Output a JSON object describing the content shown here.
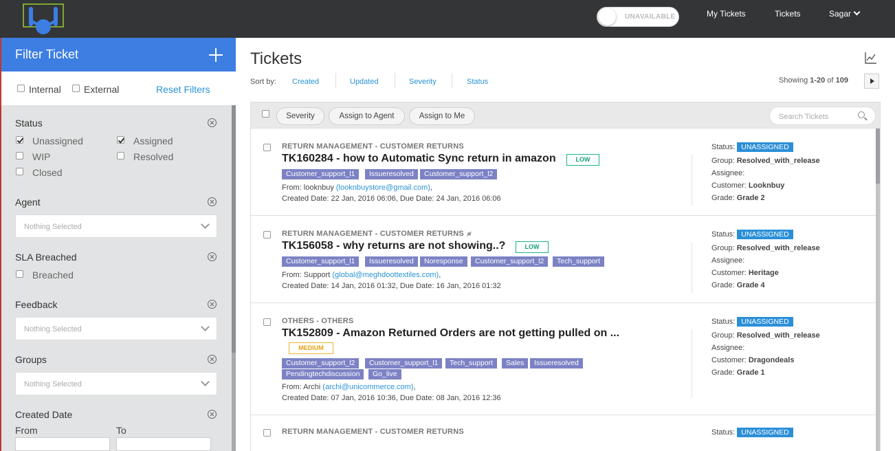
{
  "header": {
    "availability_label": "UNAVAILABLE",
    "nav": [
      "My Tickets",
      "Tickets"
    ],
    "user_name": "Sagar"
  },
  "sidebar": {
    "title": "Filter Ticket",
    "type_filters": [
      {
        "label": "Internal",
        "checked": false
      },
      {
        "label": "External",
        "checked": false
      }
    ],
    "reset_label": "Reset Filters",
    "status": {
      "label": "Status",
      "options": [
        {
          "label": "Unassigned",
          "checked": true
        },
        {
          "label": "Assigned",
          "checked": true
        },
        {
          "label": "WIP",
          "checked": false
        },
        {
          "label": "Resolved",
          "checked": false
        },
        {
          "label": "Closed",
          "checked": false
        }
      ]
    },
    "agent": {
      "label": "Agent",
      "placeholder": "Nothing Selected"
    },
    "sla": {
      "label": "SLA Breached",
      "option": "Breached"
    },
    "feedback": {
      "label": "Feedback",
      "placeholder": "Nothing Selected"
    },
    "groups": {
      "label": "Groups",
      "placeholder": "Nothing Selected"
    },
    "created_date": {
      "label": "Created Date",
      "from": "From",
      "to": "To"
    }
  },
  "main": {
    "title": "Tickets",
    "sort_label": "Sort by:",
    "sort_options": [
      "Created",
      "Updated",
      "Severity",
      "Status"
    ],
    "showing_prefix": "Showing ",
    "showing_range": "1-20",
    "showing_of": " of ",
    "showing_total": "109",
    "actions": [
      "Severity",
      "Assign to Agent",
      "Assign to Me"
    ],
    "search_placeholder": "Search Tickets"
  },
  "field_labels": {
    "status": "Status:",
    "group": "Group:",
    "assignee": "Assignee:",
    "customer": "Customer:",
    "grade": "Grade:",
    "from": "From: ",
    "created": "Created Date: ",
    "due": ", Due Date: "
  },
  "tickets": [
    {
      "category": "RETURN MANAGEMENT - CUSTOMER RETURNS",
      "title": "TK160284 - how to Automatic Sync return in amazon",
      "priority": "LOW",
      "tags": [
        "Customer_support_l1",
        "Issueresolved",
        "Customer_support_l2"
      ],
      "from_name": "looknbuy",
      "from_email": "(looknbuystore@gmail.com)",
      "created": "22 Jan, 2016 06:06",
      "due": "24 Jan, 2016 06:06",
      "status": "UNASSIGNED",
      "group": "Resolved_with_release",
      "assignee": "",
      "customer": "Looknbuy",
      "grade": "Grade 2"
    },
    {
      "category": "RETURN MANAGEMENT - CUSTOMER RETURNS",
      "title": "TK156058 - why returns are not showing..?",
      "priority": "LOW",
      "tags": [
        "Customer_support_l1",
        "Issueresolved",
        "Noresponse",
        "Customer_support_l2",
        "Tech_support"
      ],
      "from_name": "Support",
      "from_email": "(global@meghdoottextiles.com)",
      "created": "14 Jan, 2016 01:32",
      "due": "16 Jan, 2016 01:32",
      "status": "UNASSIGNED",
      "group": "Resolved_with_release",
      "assignee": "",
      "customer": "Heritage",
      "grade": "Grade 4"
    },
    {
      "category": "OTHERS - OTHERS",
      "title": "TK152809 - Amazon Returned Orders are not getting pulled on ...",
      "priority": "MEDIUM",
      "tags": [
        "Customer_support_l2",
        "Customer_support_l1",
        "Tech_support",
        "Sales",
        "Issueresolved",
        "Pendingtechdiscussion",
        "Go_live"
      ],
      "from_name": "Archi",
      "from_email": "(archi@unicommerce.com)",
      "created": "07 Jan, 2016 10:36",
      "due": "08 Jan, 2016 12:36",
      "status": "UNASSIGNED",
      "group": "Resolved_with_release",
      "assignee": "",
      "customer": "Dragondeals",
      "grade": "Grade 1"
    },
    {
      "category": "RETURN MANAGEMENT - CUSTOMER RETURNS",
      "status": "UNASSIGNED"
    }
  ]
}
